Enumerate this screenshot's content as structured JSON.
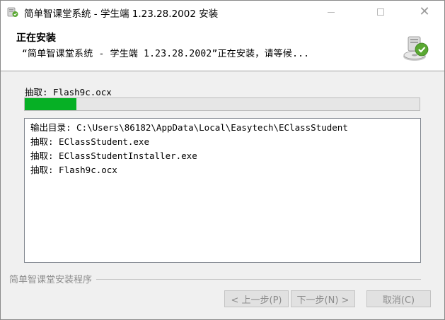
{
  "window": {
    "title": "简单智课堂系统 - 学生端 1.23.28.2002 安装"
  },
  "header": {
    "title": "正在安装",
    "subtitle": "“简单智课堂系统 - 学生端 1.23.28.2002”正在安装，请等候..."
  },
  "status": {
    "label": "抽取: Flash9c.ocx",
    "progress_percent": 13
  },
  "log": {
    "lines": [
      "输出目录: C:\\Users\\86182\\AppData\\Local\\Easytech\\EClassStudent",
      "抽取: EClassStudent.exe",
      "抽取: EClassStudentInstaller.exe",
      "抽取: Flash9c.ocx"
    ]
  },
  "branding": {
    "text": "简单智课堂安装程序"
  },
  "buttons": {
    "back": "< 上一步(P)",
    "next": "下一步(N) >",
    "cancel": "取消(C)"
  },
  "colors": {
    "progress_fill": "#06b025",
    "disabled_text": "#8b8b8b"
  }
}
